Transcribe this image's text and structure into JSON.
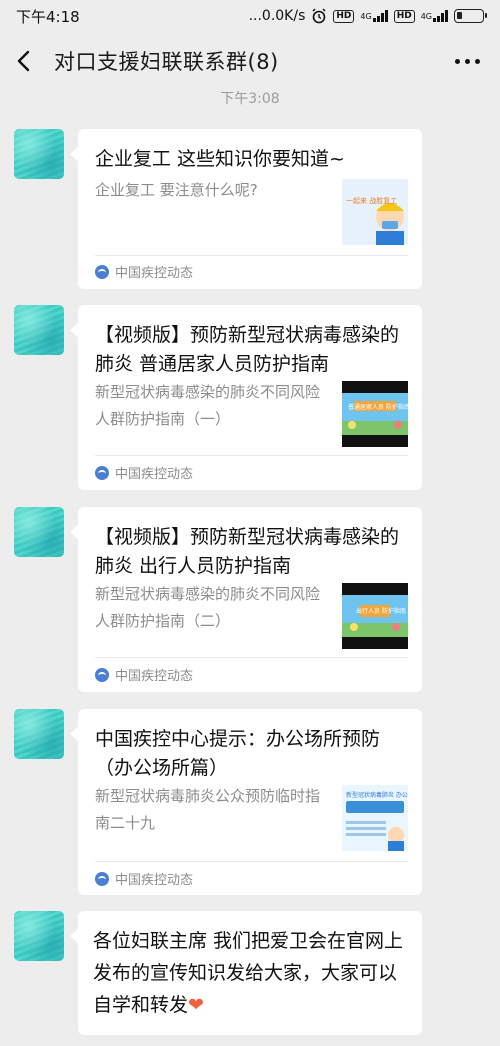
{
  "status": {
    "time": "下午4:18",
    "network_speed": "...0.0K/s",
    "net_label_1": "4G",
    "net_label_2": "4G",
    "hd_label": "HD"
  },
  "nav": {
    "title": "对口支援妇联联系群(8)"
  },
  "chat": {
    "timestamp": "下午3:08",
    "messages": [
      {
        "type": "article",
        "title": "企业复工 这些知识你要知道~",
        "desc": "企业复工 要注意什么呢?",
        "source": "中国疾控动态",
        "thumb_text": "一起来 战胜复工"
      },
      {
        "type": "article",
        "title": "【视频版】预防新型冠状病毒感染的肺炎 普通居家人员防护指南",
        "desc": "新型冠状病毒感染的肺炎不同风险人群防护指南（一）",
        "source": "中国疾控动态",
        "thumb_text": "普通居家人员 防护指南"
      },
      {
        "type": "article",
        "title": "【视频版】预防新型冠状病毒感染的肺炎 出行人员防护指南",
        "desc": "新型冠状病毒感染的肺炎不同风险人群防护指南（二）",
        "source": "中国疾控动态",
        "thumb_text": "出行人员 防护指南"
      },
      {
        "type": "article",
        "title": "中国疾控中心提示：办公场所预防（办公场所篇）",
        "desc": "新型冠状病毒肺炎公众预防临时指南二十九",
        "source": "中国疾控动态",
        "thumb_text": "新型冠状病毒肺炎 办公场所预防 临时指南"
      },
      {
        "type": "text",
        "text": "各位妇联主席 我们把爱卫会在官网上发布的宣传知识发给大家，大家可以自学和转发",
        "emoji": "❤"
      }
    ]
  },
  "colors": {
    "background": "#ededed",
    "bubble": "#ffffff",
    "muted_text": "#8c8c8c",
    "avatar": "#44c9c2",
    "heart": "#f0603a"
  }
}
